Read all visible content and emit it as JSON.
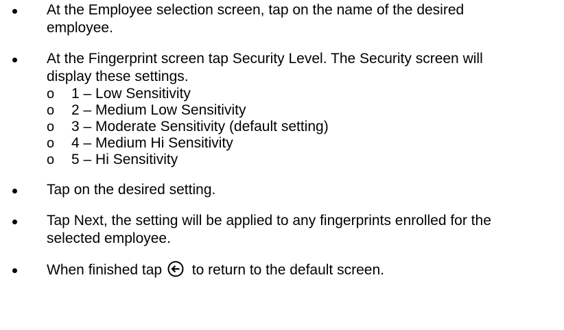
{
  "steps": [
    {
      "text": "At the Employee selection screen, tap on the name of the desired employee."
    },
    {
      "text": "At the Fingerprint screen tap Security Level. The Security screen will display these settings."
    },
    {
      "text": "Tap on the desired setting."
    },
    {
      "text": "Tap Next, the setting will be applied to any fingerprints enrolled for the selected employee."
    },
    {
      "text_before_icon": "When finished tap",
      "icon": "circle-left-arrow-icon",
      "text_after_icon": "to return to the default screen."
    }
  ],
  "security_levels": {
    "marker": "o",
    "items": [
      "1 – Low Sensitivity",
      "2 – Medium Low Sensitivity",
      "3 – Moderate Sensitivity (default setting)",
      "4 – Medium Hi Sensitivity",
      "5 – Hi Sensitivity"
    ]
  }
}
